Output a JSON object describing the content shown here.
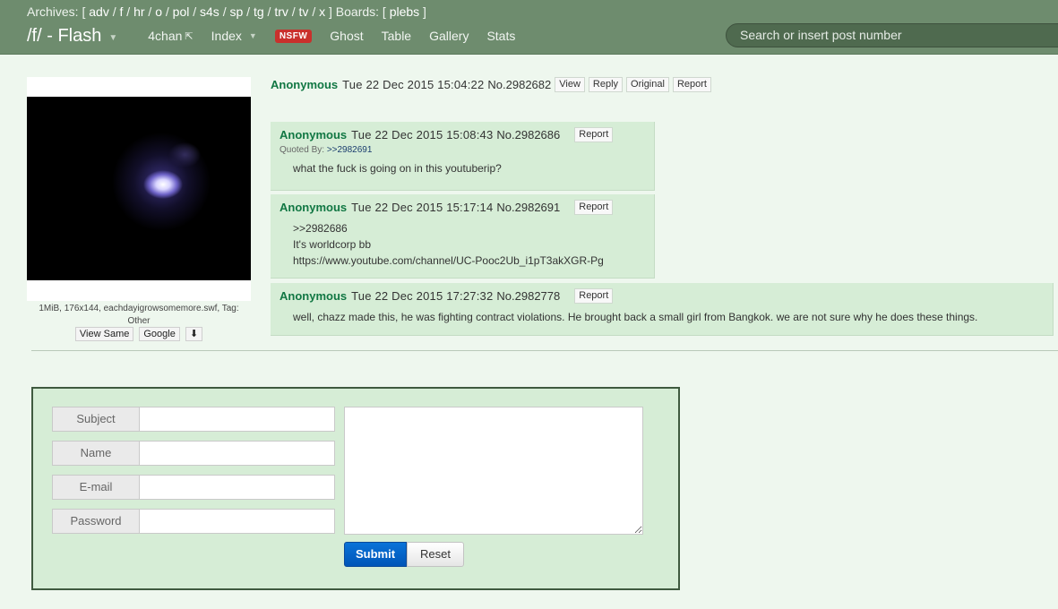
{
  "archives": {
    "label": "Archives:",
    "boards": [
      "adv",
      "f",
      "hr",
      "o",
      "pol",
      "s4s",
      "sp",
      "tg",
      "trv",
      "tv",
      "x"
    ],
    "boards_label": "Boards:",
    "boards2": [
      "plebs"
    ]
  },
  "nav": {
    "brand": "/f/ - Flash",
    "links": [
      {
        "label": "4chan"
      },
      {
        "label": "Index"
      },
      {
        "label": "Ghost"
      },
      {
        "label": "Table"
      },
      {
        "label": "Gallery"
      },
      {
        "label": "Stats"
      }
    ],
    "nsfw": "NSFW",
    "search_placeholder": "Search or insert post number"
  },
  "thread": {
    "file_info": "1MiB, 176x144, eachdayigrowsomemore.swf, Tag: Other",
    "thumb_buttons": [
      "View Same",
      "Google"
    ],
    "op": {
      "author": "Anonymous",
      "date": "Tue 22 Dec 2015 15:04:22",
      "post_no": "No.2982682",
      "buttons": [
        "View",
        "Reply",
        "Original",
        "Report"
      ]
    },
    "replies": [
      {
        "author": "Anonymous",
        "date": "Tue 22 Dec 2015 15:08:43",
        "post_no": "No.2982686",
        "report": "Report",
        "quoted_by_label": "Quoted By:",
        "quoted_by": ">>2982691",
        "lines": [
          "what the fuck is going on in this youtuberip?"
        ]
      },
      {
        "author": "Anonymous",
        "date": "Tue 22 Dec 2015 15:17:14",
        "post_no": "No.2982691",
        "report": "Report",
        "lines": [
          ">>2982686",
          "It's worldcorp bb",
          "https://www.youtube.com/channel/UC-Pooc2Ub_i1pT3akXGR-Pg"
        ]
      },
      {
        "author": "Anonymous",
        "date": "Tue 22 Dec 2015 17:27:32",
        "post_no": "No.2982778",
        "report": "Report",
        "lines": [
          "well, chazz made this, he was fighting contract violations. He brought back a small girl from Bangkok. we are not sure why he does these things."
        ]
      }
    ]
  },
  "form": {
    "fields": [
      {
        "label": "Subject",
        "value": ""
      },
      {
        "label": "Name",
        "value": ""
      },
      {
        "label": "E-mail",
        "value": ""
      },
      {
        "label": "Password",
        "value": ""
      }
    ],
    "submit": "Submit",
    "reset": "Reset"
  },
  "colors": {
    "topbar": "#6e8c6e",
    "page_bg": "#eef7ee",
    "reply_bg": "#d6edd6",
    "author": "#117743",
    "nsfw": "#c9302c",
    "submit": "#0a73d8"
  }
}
